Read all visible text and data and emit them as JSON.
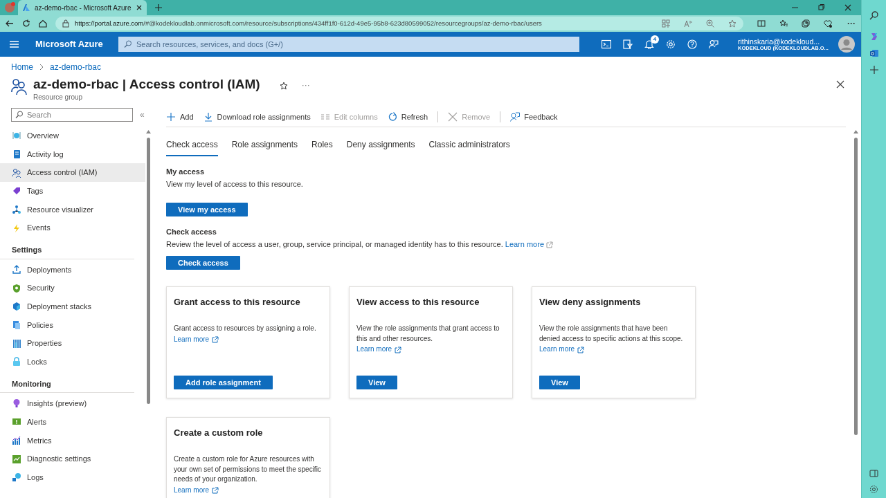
{
  "browser": {
    "tab_title": "az-demo-rbac - Microsoft Azure",
    "url_host": "https://portal.azure.com",
    "url_path": "/#@kodekloudlab.onmicrosoft.com/resource/subscriptions/434ff1f0-612d-49e5-95b8-623d80599052/resourcegroups/az-demo-rbac/users",
    "more": "···"
  },
  "header": {
    "brand": "Microsoft Azure",
    "search": {
      "placeholder": "Search resources, services, and docs (G+/)"
    },
    "notification_count": "4",
    "user_email": "rithinskaria@kodekloud...",
    "user_tenant": "KODEKLOUD (KODEKLOUDLAB.O..."
  },
  "breadcrumb": [
    "Home",
    "az-demo-rbac"
  ],
  "page": {
    "title": "az-demo-rbac | Access control (IAM)",
    "subtitle": "Resource group",
    "more": "···"
  },
  "sidebar": {
    "search": {
      "placeholder": "Search"
    },
    "collapse": "«",
    "sections": [
      {
        "items": [
          {
            "label": "Overview",
            "selected": false
          },
          {
            "label": "Activity log",
            "selected": false
          },
          {
            "label": "Access control (IAM)",
            "selected": true
          },
          {
            "label": "Tags",
            "selected": false
          },
          {
            "label": "Resource visualizer",
            "selected": false
          },
          {
            "label": "Events",
            "selected": false
          }
        ]
      },
      {
        "header": "Settings",
        "items": [
          {
            "label": "Deployments",
            "selected": false
          },
          {
            "label": "Security",
            "selected": false
          },
          {
            "label": "Deployment stacks",
            "selected": false
          },
          {
            "label": "Policies",
            "selected": false
          },
          {
            "label": "Properties",
            "selected": false
          },
          {
            "label": "Locks",
            "selected": false
          }
        ]
      },
      {
        "header": "Monitoring",
        "items": [
          {
            "label": "Insights (preview)",
            "selected": false
          },
          {
            "label": "Alerts",
            "selected": false
          },
          {
            "label": "Metrics",
            "selected": false
          },
          {
            "label": "Diagnostic settings",
            "selected": false
          },
          {
            "label": "Logs",
            "selected": false
          }
        ]
      }
    ]
  },
  "toolbar": [
    {
      "label": "Add",
      "disabled": false,
      "separator_after": false
    },
    {
      "label": "Download role assignments",
      "disabled": false,
      "separator_after": false
    },
    {
      "label": "Edit columns",
      "disabled": true,
      "separator_after": false
    },
    {
      "label": "Refresh",
      "disabled": false,
      "separator_after": true
    },
    {
      "label": "Remove",
      "disabled": true,
      "separator_after": true
    },
    {
      "label": "Feedback",
      "disabled": false,
      "separator_after": false
    }
  ],
  "tabs": [
    {
      "label": "Check access",
      "selected": true
    },
    {
      "label": "Role assignments",
      "selected": false
    },
    {
      "label": "Roles",
      "selected": false
    },
    {
      "label": "Deny assignments",
      "selected": false
    },
    {
      "label": "Classic administrators",
      "selected": false
    }
  ],
  "my_access": {
    "heading": "My access",
    "text": "View my level of access to this resource.",
    "button": "View my access"
  },
  "check_access": {
    "heading": "Check access",
    "text": "Review the level of access a user, group, service principal, or managed identity has to this resource.",
    "link": "Learn more",
    "button": "Check access"
  },
  "cards": [
    {
      "title": "Grant access to this resource",
      "text": "Grant access to resources by assigning a role.",
      "link": "Learn more",
      "button": "Add role assignment"
    },
    {
      "title": "View access to this resource",
      "text": "View the role assignments that grant access to this and other resources.",
      "link": "Learn more",
      "button": "View"
    },
    {
      "title": "View deny assignments",
      "text": "View the role assignments that have been denied access to specific actions at this scope.",
      "link": "Learn more",
      "button": "View"
    },
    {
      "title": "Create a custom role",
      "text": "Create a custom role for Azure resources with your own set of permissions to meet the specific needs of your organization.",
      "link": "Learn more"
    }
  ]
}
